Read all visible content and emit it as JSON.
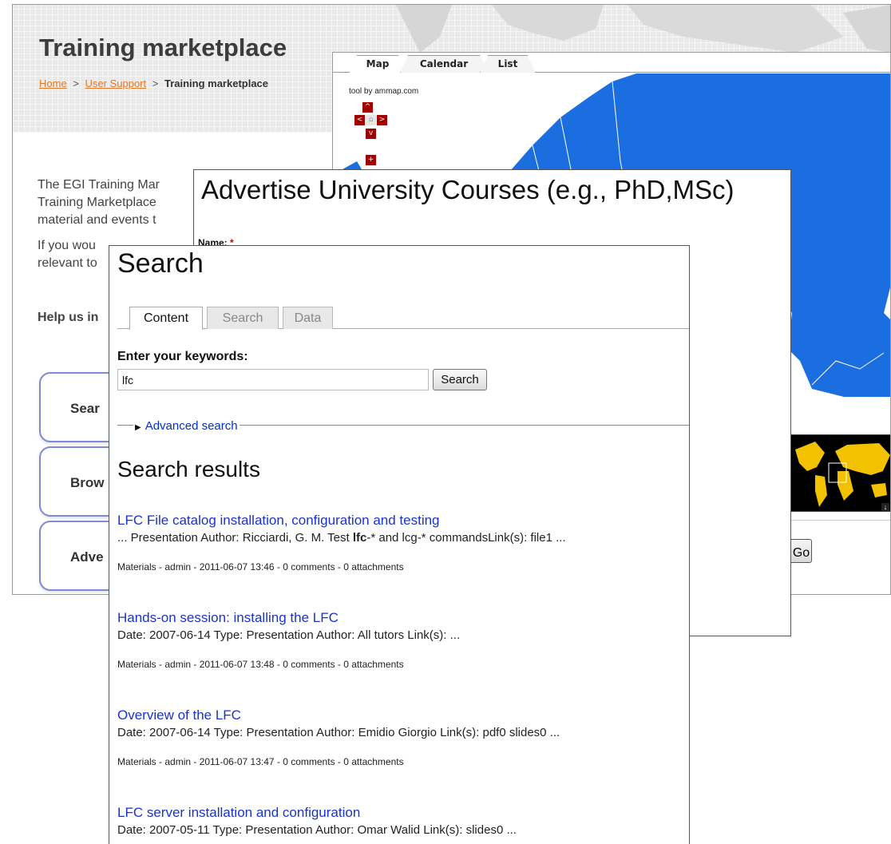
{
  "egi_page": {
    "title": "Training marketplace",
    "breadcrumb": {
      "home": "Home",
      "sep1": ">",
      "user_support": "User Support",
      "sep2": ">",
      "current": "Training marketplace"
    },
    "intro": [
      "The EGI Training Mar",
      "Training Marketplace",
      "material and events t"
    ],
    "intro2": [
      "If you wou",
      "relevant to"
    ],
    "help": "Help us in",
    "buttons": [
      "Sear",
      "Brow",
      "Adve"
    ]
  },
  "map_widget": {
    "tabs": [
      "Map",
      "Calendar",
      "List"
    ],
    "active_tab": "Map",
    "credit": "tool by ammap.com",
    "go_label": "Go",
    "colors": {
      "land": "#1a6ee0",
      "nav": "#a00000",
      "minimap_land": "#f2c200"
    }
  },
  "advertise_form": {
    "title": "Advertise University Courses (e.g., PhD,MSc)",
    "name_label": "Name:",
    "required_mark": "*"
  },
  "search_page": {
    "title": "Search",
    "tabs": [
      "Content",
      "Search",
      "Data"
    ],
    "active_tab": "Content",
    "keywords_label": "Enter your keywords:",
    "keywords_value": "lfc",
    "search_button": "Search",
    "advanced_label": "Advanced search",
    "results_heading": "Search results",
    "results": [
      {
        "title": "LFC File catalog installation, configuration and testing",
        "snippet_pre": "... Presentation Author: Ricciardi, G. M. Test ",
        "snippet_bold": "lfc",
        "snippet_post": "-* and lcg-* commandsLink(s): file1 ...",
        "meta": "Materials - admin - 2011-06-07 13:46 - 0 comments - 0 attachments"
      },
      {
        "title": "Hands-on session: installing the LFC",
        "snippet": "Date: 2007-06-14 Type: Presentation Author: All tutors Link(s): ...",
        "meta": "Materials - admin - 2011-06-07 13:48 - 0 comments - 0 attachments"
      },
      {
        "title": "Overview of the LFC",
        "snippet": "Date: 2007-06-14 Type: Presentation Author: Emidio Giorgio Link(s): pdf0 slides0 ...",
        "meta": "Materials - admin - 2011-06-07 13:47 - 0 comments - 0 attachments"
      },
      {
        "title": "LFC server installation and configuration",
        "snippet": "Date: 2007-05-11 Type: Presentation Author: Omar Walid Link(s): slides0 ..."
      }
    ]
  }
}
